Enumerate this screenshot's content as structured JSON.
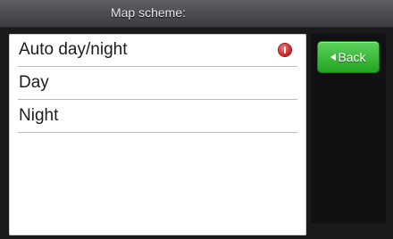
{
  "header": {
    "title": "Map scheme:"
  },
  "list": {
    "items": [
      {
        "label": "Auto day/night",
        "selected": true,
        "indicator_icon": "red-info-dot-icon"
      },
      {
        "label": "Day",
        "selected": false
      },
      {
        "label": "Night",
        "selected": false
      }
    ]
  },
  "side": {
    "back_label": "Back",
    "back_icon": "left-arrow-icon"
  },
  "colors": {
    "header_bg": "#4a4a4f",
    "list_bg": "#ffffff",
    "back_button": "#3bbd3b",
    "selected_indicator": "#d12a2a"
  }
}
